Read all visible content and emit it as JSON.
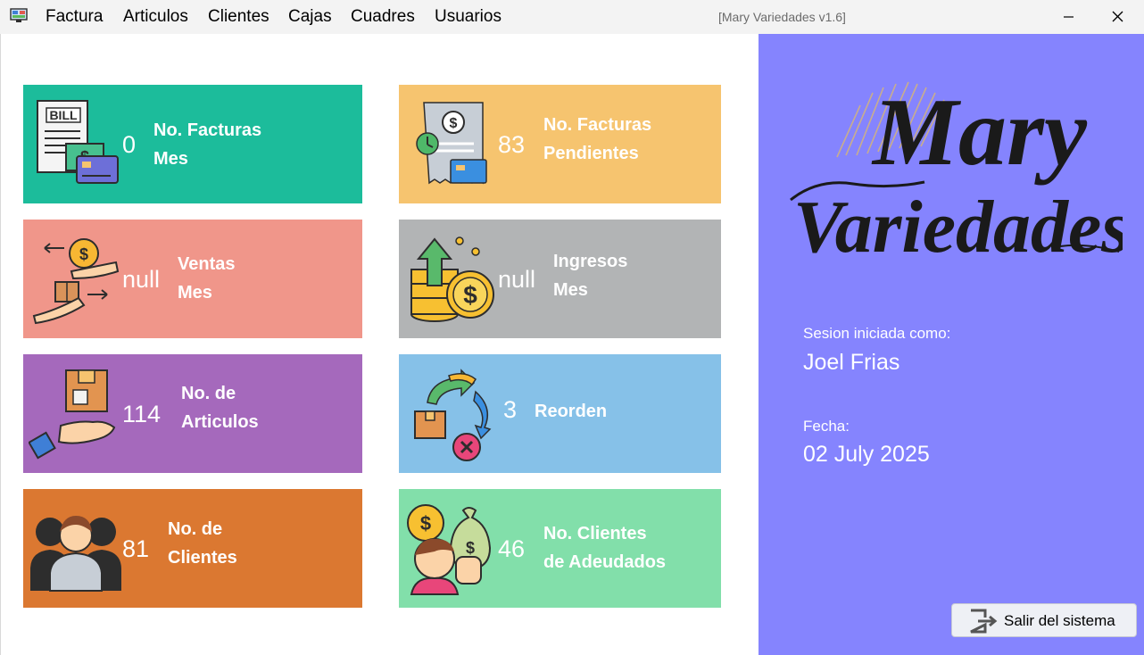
{
  "menubar": {
    "items": [
      "Factura",
      "Articulos",
      "Clientes",
      "Cajas",
      "Cuadres",
      "Usuarios"
    ]
  },
  "window": {
    "title": "[Mary Variedades v1.6]"
  },
  "cards": [
    {
      "value": "0",
      "label_line1": "No. Facturas",
      "label_line2": "Mes",
      "color": "#1cbc9b",
      "icon": "bill-icon"
    },
    {
      "value": "83",
      "label_line1": "No. Facturas",
      "label_line2": "Pendientes",
      "color": "#f6c46f",
      "icon": "pending-invoice-icon"
    },
    {
      "value": "null",
      "label_line1": "Ventas",
      "label_line2": "Mes",
      "color": "#f0968a",
      "icon": "sales-exchange-icon"
    },
    {
      "value": "null",
      "label_line1": "Ingresos",
      "label_line2": "Mes",
      "color": "#b2b4b5",
      "icon": "income-coins-icon"
    },
    {
      "value": "114",
      "label_line1": "No. de",
      "label_line2": "Articulos",
      "color": "#a569bc",
      "icon": "hand-box-icon"
    },
    {
      "value": "3",
      "label_line1": "Reorden",
      "label_line2": "",
      "color": "#86c1e8",
      "icon": "reorder-icon"
    },
    {
      "value": "81",
      "label_line1": "No. de",
      "label_line2": "Clientes",
      "color": "#db7831",
      "icon": "customers-icon"
    },
    {
      "value": "46",
      "label_line1": "No. Clientes",
      "label_line2": "de Adeudados",
      "color": "#82dfaa",
      "icon": "debtor-icon"
    }
  ],
  "sidebar": {
    "logo_line1": "Mary",
    "logo_line2": "Variedades",
    "session_label": "Sesion iniciada como:",
    "user_name": "Joel Frias",
    "date_label": "Fecha:",
    "date_value": "02 July 2025",
    "logout_label": "Salir del sistema",
    "bg_color": "#8584fe"
  }
}
